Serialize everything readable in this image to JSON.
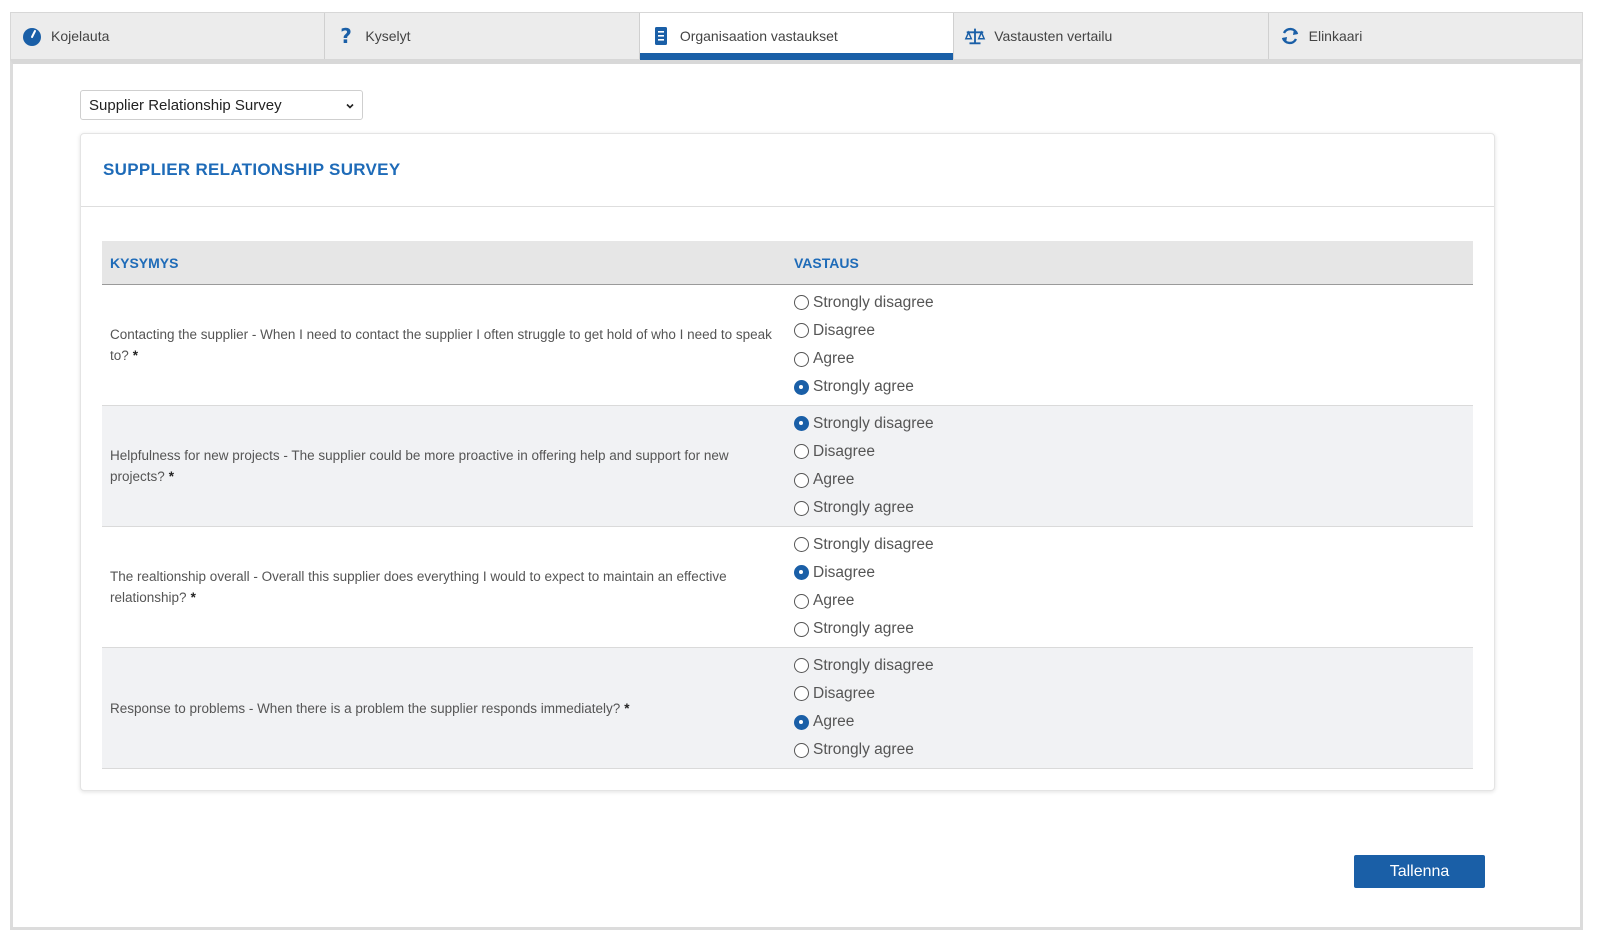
{
  "tabs": [
    {
      "label": "Kojelauta",
      "icon": "dashboard-gauge-icon",
      "active": false
    },
    {
      "label": "Kyselyt",
      "icon": "question-mark-icon",
      "active": false
    },
    {
      "label": "Organisaation vastaukset",
      "icon": "document-list-icon",
      "active": true
    },
    {
      "label": "Vastausten vertailu",
      "icon": "balance-scale-icon",
      "active": false
    },
    {
      "label": "Elinkaari",
      "icon": "refresh-icon",
      "active": false
    }
  ],
  "survey_select": {
    "value": "Supplier Relationship Survey"
  },
  "card": {
    "title": "SUPPLIER RELATIONSHIP SURVEY"
  },
  "table": {
    "col_question": "KYSYMYS",
    "col_answer": "VASTAUS",
    "rows": [
      {
        "question": "Contacting the supplier - When I need to contact the supplier I often struggle to get hold of who I need to speak to?",
        "required_mark": "*",
        "options": [
          "Strongly disagree",
          "Disagree",
          "Agree",
          "Strongly agree"
        ],
        "selected": 3
      },
      {
        "question": "Helpfulness for new projects - The supplier could be more proactive in offering help and support for new projects?",
        "required_mark": "*",
        "options": [
          "Strongly disagree",
          "Disagree",
          "Agree",
          "Strongly agree"
        ],
        "selected": 0
      },
      {
        "question": "The realtionship overall - Overall this supplier does everything I would to expect to maintain an effective relationship?",
        "required_mark": "*",
        "options": [
          "Strongly disagree",
          "Disagree",
          "Agree",
          "Strongly agree"
        ],
        "selected": 1
      },
      {
        "question": "Response to problems - When there is a problem the supplier responds immediately?",
        "required_mark": "*",
        "options": [
          "Strongly disagree",
          "Disagree",
          "Agree",
          "Strongly agree"
        ],
        "selected": 2
      }
    ]
  },
  "save_button": {
    "label": "Tallenna"
  },
  "colors": {
    "accent": "#1a5fa7",
    "heading": "#1e6bb8"
  }
}
